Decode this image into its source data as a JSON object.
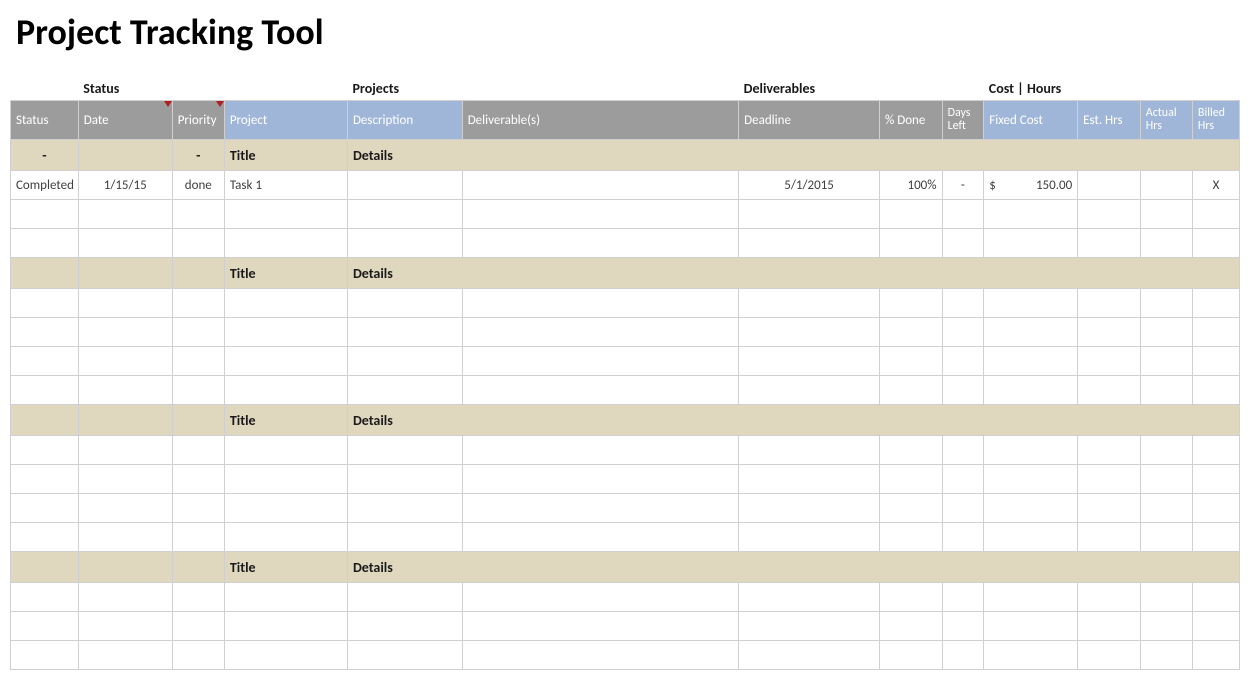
{
  "title": "Project Tracking Tool",
  "sections": {
    "status": "Status",
    "projects": "Projects",
    "deliverables": "Deliverables",
    "cost": "Cost | Hours"
  },
  "headers": {
    "status": "Status",
    "date": "Date",
    "priority": "Priority",
    "project": "Project",
    "description": "Description",
    "deliverable": "Deliverable(s)",
    "deadline": "Deadline",
    "done": "% Done",
    "days": "Days Left",
    "fixed": "Fixed Cost",
    "est": "Est. Hrs",
    "actual": "Actual Hrs",
    "billed": "Billed Hrs"
  },
  "group": {
    "title": "Title",
    "details": "Details",
    "dash": "-"
  },
  "row1": {
    "status": "Completed",
    "date": "1/15/15",
    "priority": "done",
    "project": "Task 1",
    "description": "",
    "deliverable": "",
    "deadline": "5/1/2015",
    "done": "100%",
    "days": "-",
    "fixed_sym": "$",
    "fixed_val": "150.00",
    "est": "",
    "actual": "",
    "billed": "X"
  }
}
